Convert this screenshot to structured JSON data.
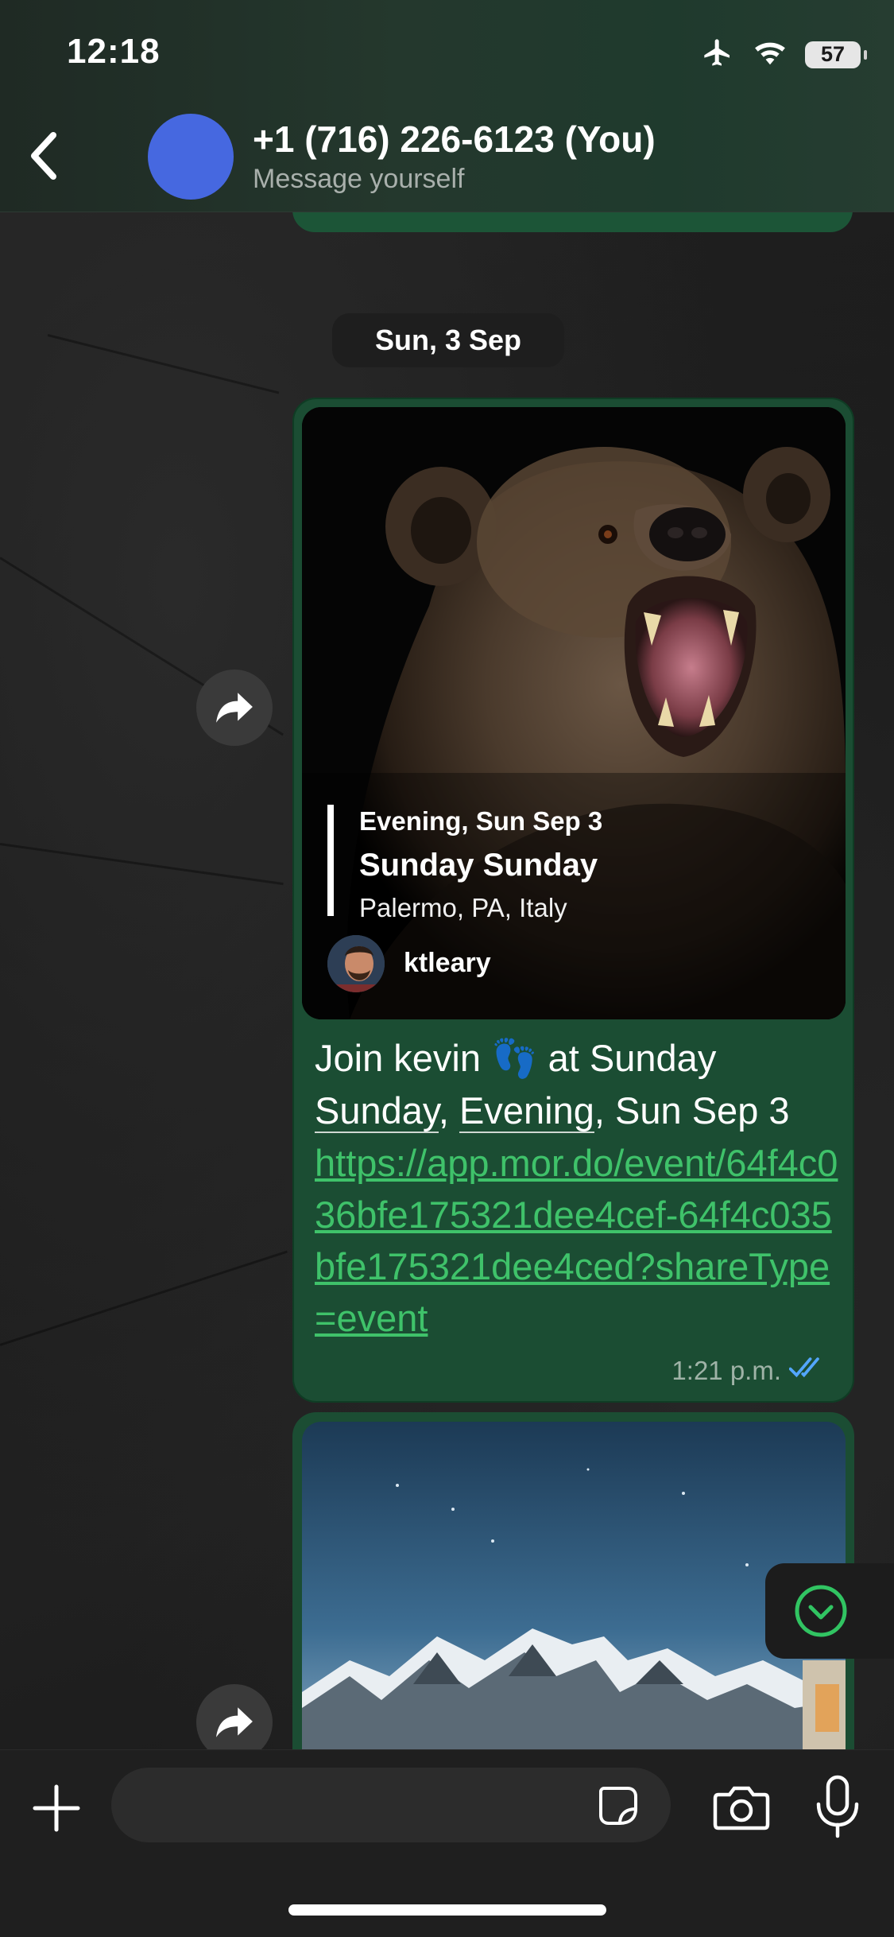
{
  "status_bar": {
    "time": "12:18",
    "battery": "57",
    "icons": [
      "airplane-icon",
      "wifi-icon",
      "battery-icon"
    ]
  },
  "header": {
    "contact_name": "+1 (716) 226-6123 (You)",
    "subtitle": "Message yourself",
    "avatar_color": "#4668e0"
  },
  "chat": {
    "date_separator": "Sun, 3 Sep",
    "messages": [
      {
        "event_card": {
          "date": "Evening, Sun Sep 3",
          "title": "Sunday Sunday",
          "location": "Palermo, PA, Italy",
          "host": "ktleary"
        },
        "text_line1_a": "Join kevin ",
        "text_emoji": "👣",
        "text_line1_b": " at Sunday",
        "text_line2_a": "Sunday",
        "text_line2_b": ",  ",
        "text_line2_c": "Evening",
        "text_line2_d": ", Sun Sep 3",
        "link": "https://app.mor.do/event/64f4c036bfe175321dee4cef-64f4c035bfe175321dee4ced?shareType=event",
        "time": "1:21 p.m.",
        "read_status": "double-check-icon"
      }
    ]
  },
  "composer": {
    "placeholder": ""
  },
  "colors": {
    "bubble": "#1b4d33",
    "link": "#3fc26a",
    "read_tick": "#53a6ff"
  }
}
